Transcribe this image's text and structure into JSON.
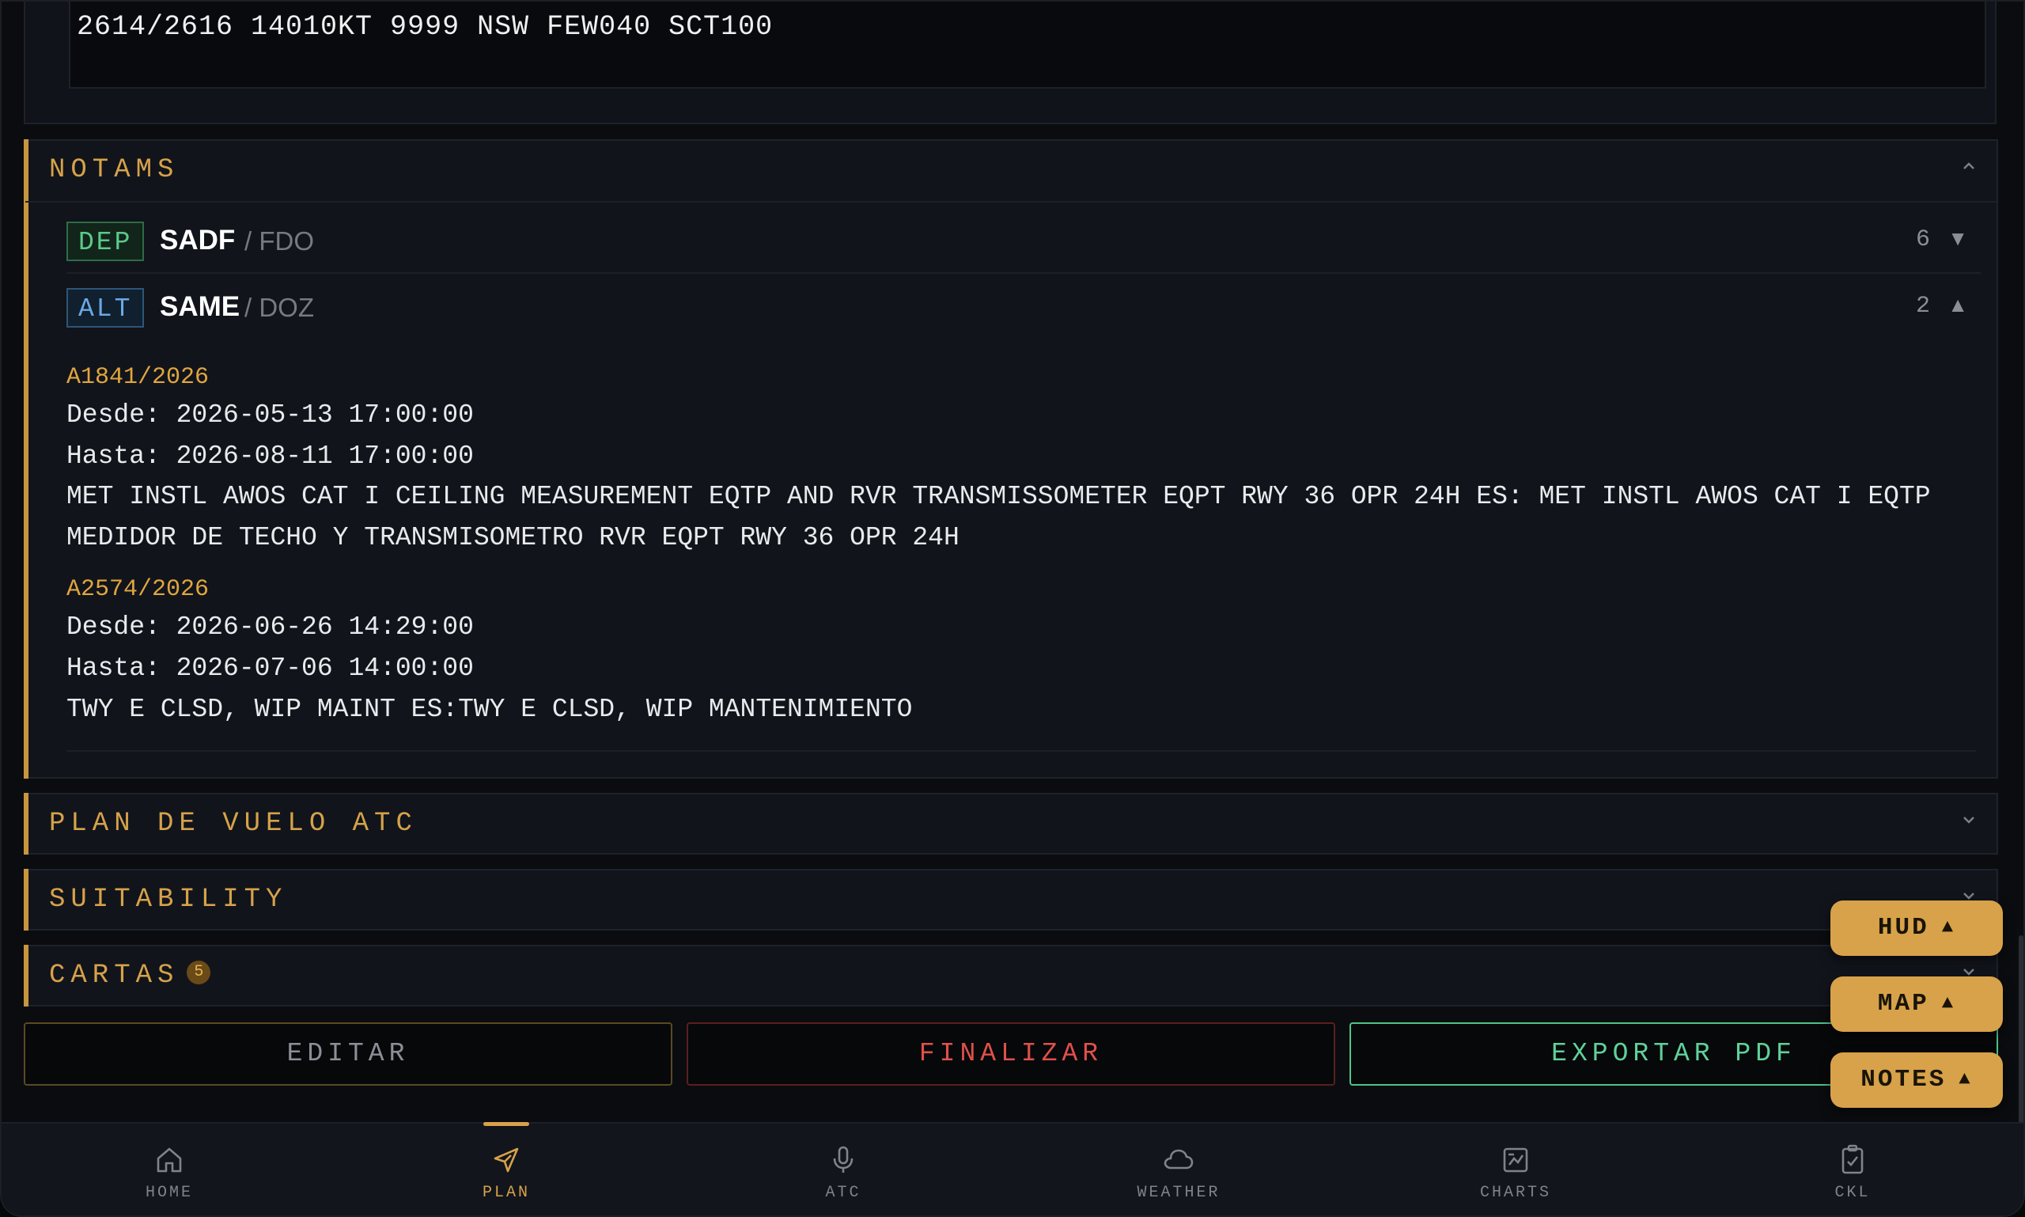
{
  "weather": {
    "taf_line": "2614/2616 14010KT 9999 NSW FEW040 SCT100"
  },
  "notams": {
    "title": "NOTAMS",
    "chevron": "^",
    "airports": [
      {
        "role": "DEP",
        "icao": "SADF",
        "iata": "/ FDO",
        "count": "6",
        "caret": "▼"
      },
      {
        "role": "ALT",
        "icao": "SAME",
        "iata": "/ DOZ",
        "count": "2",
        "caret": "▲"
      }
    ],
    "items": [
      {
        "id": "A1841/2026",
        "from": "Desde: 2026-05-13 17:00:00",
        "to": "Hasta: 2026-08-11 17:00:00",
        "text": "MET INSTL AWOS CAT I CEILING MEASUREMENT EQTP AND RVR TRANSMISSOMETER EQPT RWY 36 OPR 24H ES: MET INSTL AWOS CAT I EQTP MEDIDOR DE TECHO Y TRANSMISOMETRO RVR EQPT RWY 36 OPR 24H"
      },
      {
        "id": "A2574/2026",
        "from": "Desde: 2026-06-26 14:29:00",
        "to": "Hasta: 2026-07-06 14:00:00",
        "text": "TWY E CLSD, WIP MAINT ES:TWY E CLSD, WIP MANTENIMIENTO"
      }
    ]
  },
  "sections": {
    "plan_atc": {
      "title": "PLAN DE VUELO ATC",
      "chevron": "⌄"
    },
    "suitability": {
      "title": "SUITABILITY",
      "chevron": "⌄"
    },
    "cartas": {
      "title": "CARTAS",
      "badge": "5",
      "chevron": "⌄"
    }
  },
  "actions": {
    "edit": "EDITAR",
    "finalize": "FINALIZAR",
    "export": "EXPORTAR PDF"
  },
  "floating": {
    "hud": "HUD",
    "map": "MAP",
    "notes": "NOTES",
    "arrow": "▲"
  },
  "nav": {
    "items": [
      {
        "label": "HOME",
        "icon": "home-icon"
      },
      {
        "label": "PLAN",
        "icon": "plane-icon",
        "active": true
      },
      {
        "label": "ATC",
        "icon": "microphone-icon"
      },
      {
        "label": "WEATHER",
        "icon": "cloud-icon"
      },
      {
        "label": "CHARTS",
        "icon": "chart-icon"
      },
      {
        "label": "CKL",
        "icon": "checklist-icon"
      }
    ]
  },
  "colors": {
    "accent": "#d8a24a",
    "dep": "#5cc98a",
    "alt": "#6aa8e6",
    "danger": "#e0504a",
    "success": "#5fd19b",
    "notam_id": "#e0a63f"
  }
}
